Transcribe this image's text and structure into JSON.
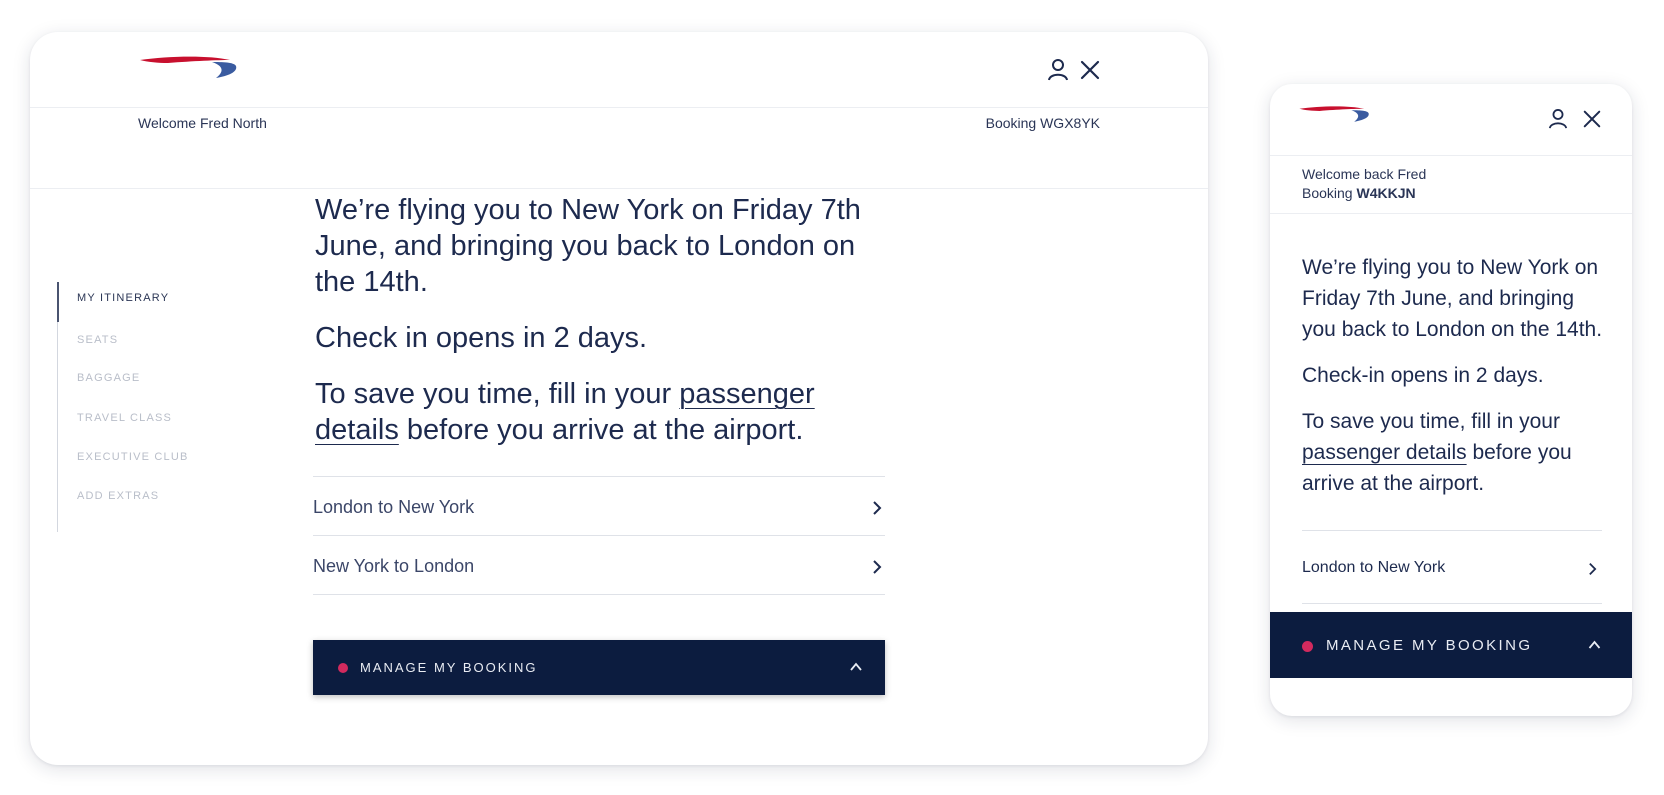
{
  "colors": {
    "brand_navy": "#0c1c3f",
    "text_primary": "#1d2a4e",
    "nav_inactive": "#b9bec9",
    "accent_dot": "#d22a5e",
    "logo_red": "#c8102e",
    "logo_blue": "#3a5ba0"
  },
  "desktop": {
    "logo_icon": "speedmarque-logo",
    "header_icons": [
      "user-icon",
      "close-icon"
    ],
    "welcome": "Welcome Fred North",
    "booking": "Booking WGX8YK",
    "nav": {
      "items": [
        {
          "label": "MY ITINERARY",
          "active": true
        },
        {
          "label": "SEATS",
          "active": false
        },
        {
          "label": "BAGGAGE",
          "active": false
        },
        {
          "label": "TRAVEL CLASS",
          "active": false
        },
        {
          "label": "EXECUTIVE CLUB",
          "active": false
        },
        {
          "label": "ADD EXTRAS",
          "active": false
        }
      ]
    },
    "hero": {
      "line1": "We’re flying you to New York on Friday 7th June, and bringing you back to London on the 14th.",
      "line2": "Check in opens in 2 days.",
      "line3_before": "To save you time, fill in your ",
      "line3_link": "passenger details",
      "line3_after": " before you arrive at the airport."
    },
    "routes": [
      {
        "label": "London to New York",
        "icon": "chevron-right-icon"
      },
      {
        "label": "New York to London",
        "icon": "chevron-right-icon"
      }
    ],
    "manage_label": "MANAGE MY BOOKING"
  },
  "mobile": {
    "logo_icon": "speedmarque-logo",
    "header_icons": [
      "user-icon",
      "close-icon"
    ],
    "welcome": "Welcome back Fred",
    "booking_prefix": "Booking ",
    "booking_code": "W4KKJN",
    "hero": {
      "line1": "We’re flying you to New York on Friday 7th June, and bringing you back to London on the 14th.",
      "line2": "Check-in opens in 2 days.",
      "line3_before": "To save you time, fill in your ",
      "line3_link": "passenger details",
      "line3_after": " before you arrive at the airport."
    },
    "routes": [
      {
        "label": "London to New York",
        "icon": "chevron-right-icon"
      }
    ],
    "manage_label": "MANAGE MY BOOKING"
  }
}
